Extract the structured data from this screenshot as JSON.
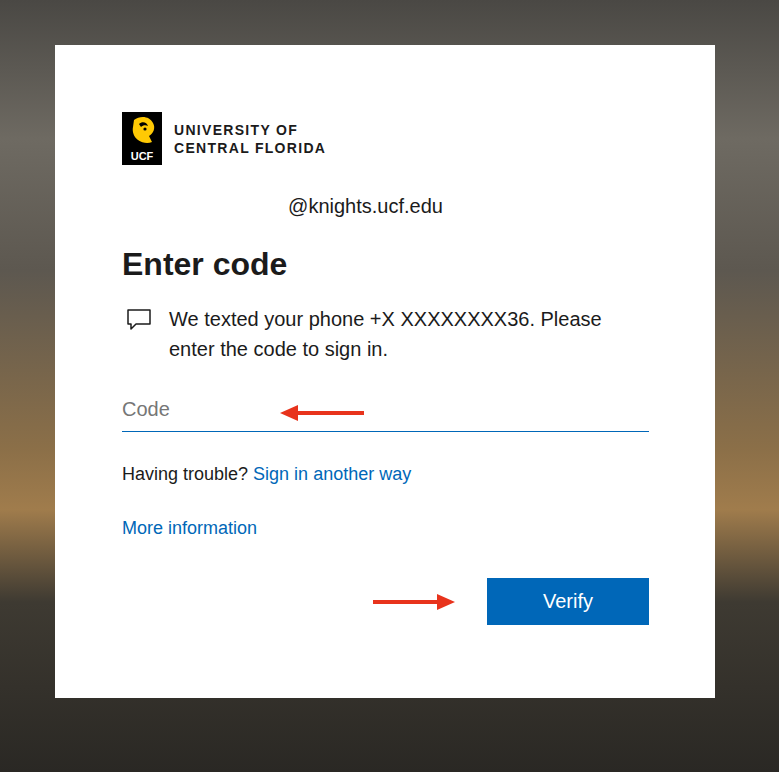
{
  "logo": {
    "mark": "UCF",
    "name_lines": [
      "UNIVERSITY OF",
      "CENTRAL FLORIDA"
    ]
  },
  "account": "@knights.ucf.edu",
  "title": "Enter code",
  "message": "We texted your phone +X XXXXXXXX36. Please enter the code to sign in.",
  "code_field": {
    "placeholder": "Code",
    "focused": true
  },
  "help": {
    "prompt": "Having trouble?",
    "link": "Sign in another way"
  },
  "more_info": "More information",
  "buttons": [
    "Verify"
  ]
}
